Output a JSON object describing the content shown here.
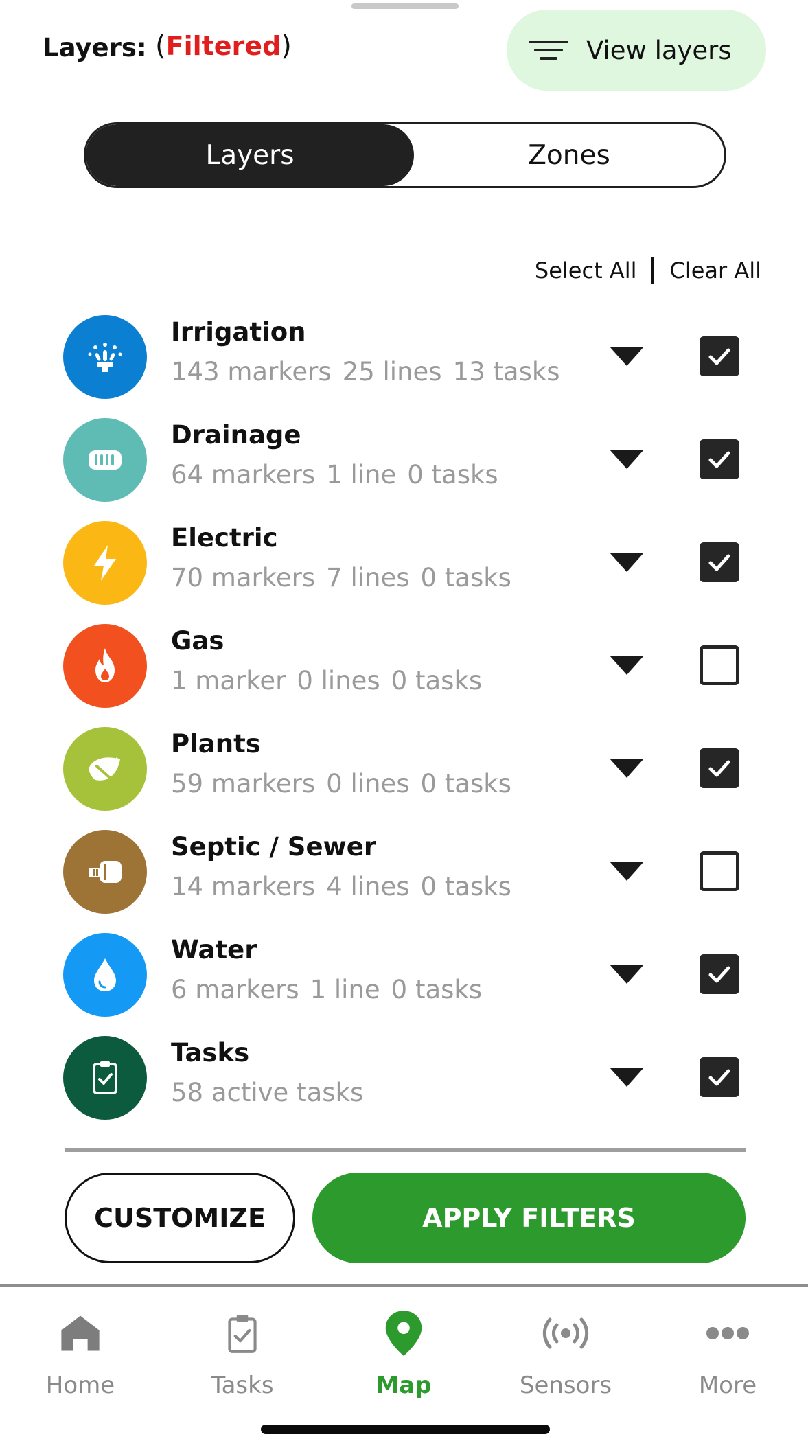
{
  "header": {
    "title": "Layers:",
    "status_open": "(",
    "status_text": "Filtered",
    "status_close": ")",
    "view_layers_label": "View layers"
  },
  "segment": {
    "tabs": [
      {
        "label": "Layers",
        "active": true
      },
      {
        "label": "Zones",
        "active": false
      }
    ]
  },
  "actions": {
    "select_all": "Select All",
    "clear_all": "Clear All"
  },
  "layers": [
    {
      "name": "Irrigation",
      "stats": [
        "143 markers",
        "25 lines",
        "13 tasks"
      ],
      "checked": true,
      "color": "#0b7fd1",
      "icon": "sprinkler-icon"
    },
    {
      "name": "Drainage",
      "stats": [
        "64 markers",
        "1 line",
        "0 tasks"
      ],
      "checked": true,
      "color": "#5fbcb5",
      "icon": "drain-grate-icon"
    },
    {
      "name": "Electric",
      "stats": [
        "70 markers",
        "7 lines",
        "0 tasks"
      ],
      "checked": true,
      "color": "#fbb713",
      "icon": "lightning-icon"
    },
    {
      "name": "Gas",
      "stats": [
        "1 marker",
        "0 lines",
        "0 tasks"
      ],
      "checked": false,
      "color": "#f2511f",
      "icon": "flame-icon"
    },
    {
      "name": "Plants",
      "stats": [
        "59 markers",
        "0 lines",
        "0 tasks"
      ],
      "checked": true,
      "color": "#a6c23a",
      "icon": "leaf-icon"
    },
    {
      "name": "Septic / Sewer",
      "stats": [
        "14 markers",
        "4 lines",
        "0 tasks"
      ],
      "checked": false,
      "color": "#9e7336",
      "icon": "septic-tank-icon"
    },
    {
      "name": "Water",
      "stats": [
        "6 markers",
        "1 line",
        "0 tasks"
      ],
      "checked": true,
      "color": "#149af5",
      "icon": "water-drop-icon"
    },
    {
      "name": "Tasks",
      "stats": [
        "58 active tasks"
      ],
      "checked": true,
      "color": "#0d5b3e",
      "icon": "clipboard-check-icon"
    }
  ],
  "buttons": {
    "customize": "CUSTOMIZE",
    "apply": "APPLY FILTERS"
  },
  "tabbar": {
    "items": [
      {
        "label": "Home",
        "icon": "home-icon",
        "active": false
      },
      {
        "label": "Tasks",
        "icon": "clipboard-check-icon",
        "active": false
      },
      {
        "label": "Map",
        "icon": "map-pin-icon",
        "active": true
      },
      {
        "label": "Sensors",
        "icon": "broadcast-icon",
        "active": false
      },
      {
        "label": "More",
        "icon": "more-dots-icon",
        "active": false
      }
    ]
  },
  "colors": {
    "accent_green": "#2c9a2c",
    "filtered_red": "#e01e1e",
    "view_layers_bg": "#dff6df",
    "dark": "#212121"
  }
}
